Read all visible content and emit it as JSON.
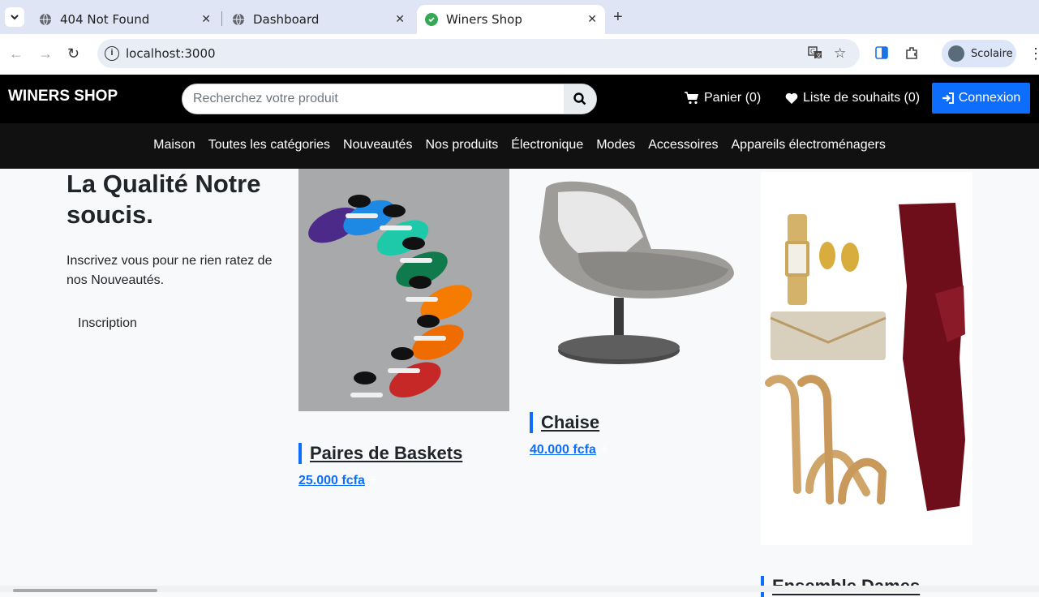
{
  "browser": {
    "tabs": [
      {
        "title": "404 Not Found",
        "active": false
      },
      {
        "title": "Dashboard",
        "active": false
      },
      {
        "title": "Winers Shop",
        "active": true
      }
    ],
    "url": "localhost:3000",
    "profile_name": "Scolaire"
  },
  "header": {
    "brand": "WINERS SHOP",
    "search_placeholder": "Recherchez votre produit",
    "cart_label": "Panier (0)",
    "wishlist_label": "Liste de souhaits (0)",
    "login_label": "Connexion",
    "accent_color": "#0d6efd"
  },
  "categories": [
    "Maison",
    "Toutes les catégories",
    "Nouveautés",
    "Nos produits",
    "Électronique",
    "Modes",
    "Accessoires",
    "Appareils électroménagers"
  ],
  "hero": {
    "title": "La Qualité Notre soucis.",
    "text": "Inscrivez vous pour ne rien ratez de nos Nouveautés.",
    "button": "Inscription"
  },
  "products": [
    {
      "name": "Paires de Baskets",
      "price": "25.000 fcfa",
      "image": "sneakers"
    },
    {
      "name": "Chaise",
      "price": "40.000 fcfa",
      "image": "chair"
    },
    {
      "name": "Ensemble Dames",
      "price": "",
      "image": "women-outfit"
    }
  ]
}
